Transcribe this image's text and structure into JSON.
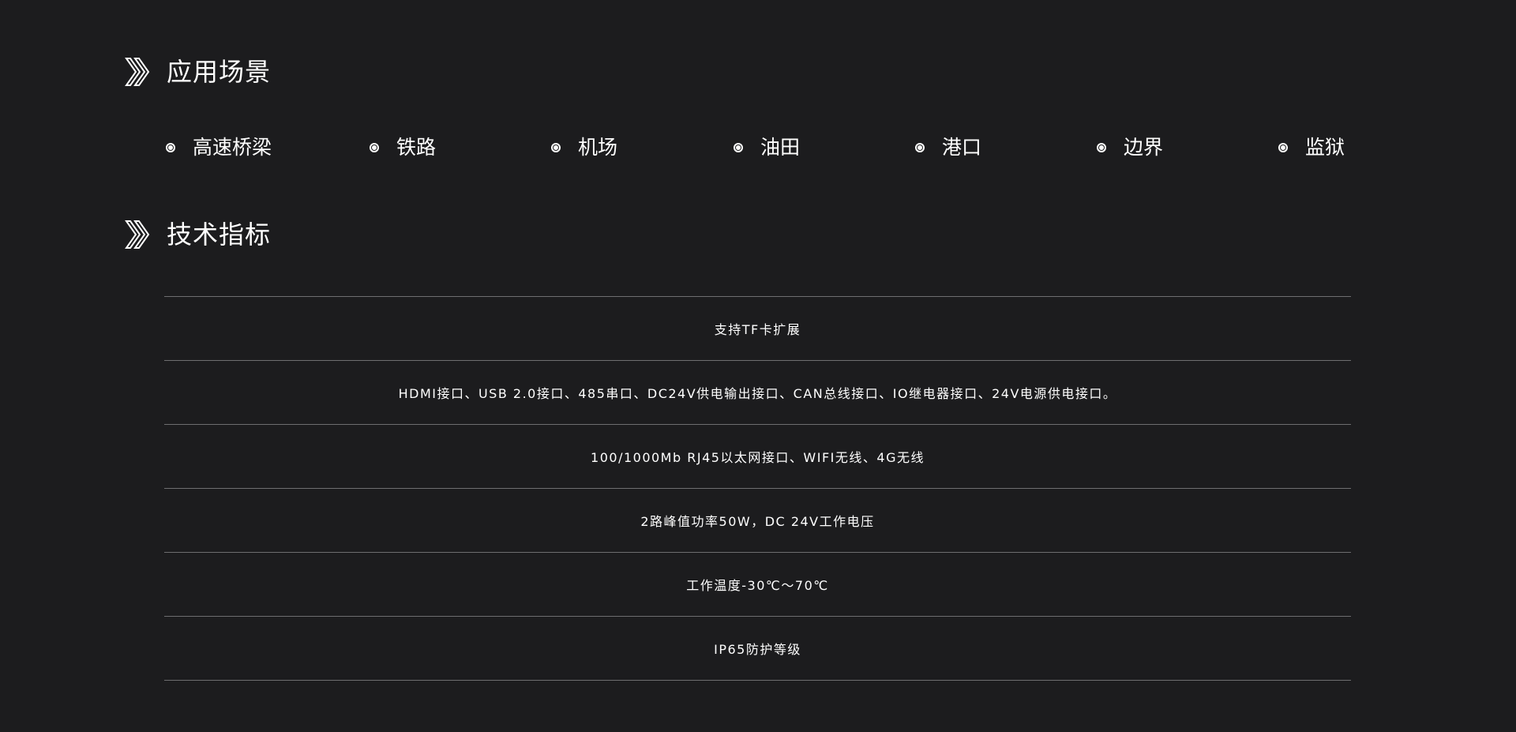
{
  "sections": {
    "scenarios_title": "应用场景",
    "specs_title": "技术指标"
  },
  "scenarios": [
    {
      "label": "高速桥梁"
    },
    {
      "label": "铁路"
    },
    {
      "label": "机场"
    },
    {
      "label": "油田"
    },
    {
      "label": "港口"
    },
    {
      "label": "边界"
    },
    {
      "label": "监狱"
    }
  ],
  "specs": [
    {
      "text": "支持TF卡扩展"
    },
    {
      "text": "HDMI接口、USB 2.0接口、485串口、DC24V供电输出接口、CAN总线接口、IO继电器接口、24V电源供电接口。"
    },
    {
      "text": "100/1000Mb RJ45以太网接口、WIFI无线、4G无线"
    },
    {
      "text": "2路峰值功率50W，DC 24V工作电压"
    },
    {
      "text": "工作温度-30℃～70℃"
    },
    {
      "text": "IP65防护等级"
    }
  ],
  "icons": {
    "section_icon": "double-chevron-right-icon",
    "bullet_icon": "radio-dot-icon"
  },
  "colors": {
    "background": "#1c1c1e",
    "text": "#ffffff",
    "divider": "#6e6e70"
  }
}
